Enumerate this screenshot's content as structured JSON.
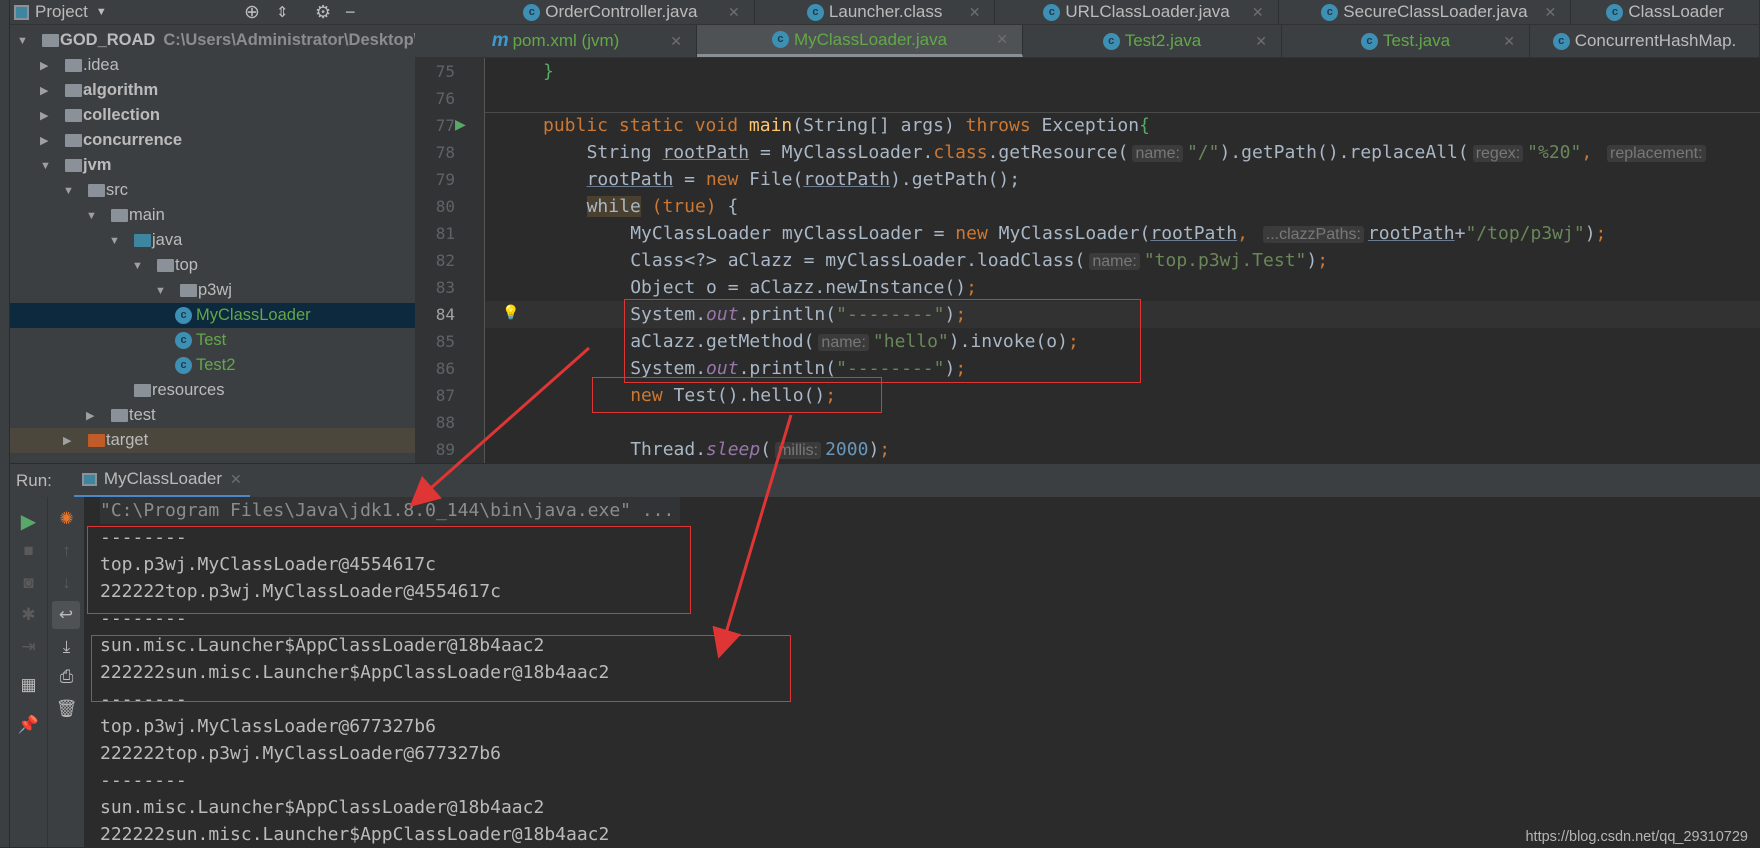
{
  "project_panel": {
    "title": "Project",
    "tree": [
      {
        "label": "GOD_ROAD",
        "path": "C:\\Users\\Administrator\\Desktop\\",
        "level": 0,
        "expanded": true,
        "icon": "module-folder",
        "bold": true
      },
      {
        "label": ".idea",
        "level": 1,
        "expanded": false,
        "icon": "folder"
      },
      {
        "label": "algorithm",
        "level": 1,
        "expanded": false,
        "icon": "module-folder",
        "bold": true
      },
      {
        "label": "collection",
        "level": 1,
        "expanded": false,
        "icon": "module-folder",
        "bold": true
      },
      {
        "label": "concurrence",
        "level": 1,
        "expanded": false,
        "icon": "module-folder",
        "bold": true
      },
      {
        "label": "jvm",
        "level": 1,
        "expanded": true,
        "icon": "module-folder",
        "bold": true
      },
      {
        "label": "src",
        "level": 2,
        "expanded": true,
        "icon": "folder"
      },
      {
        "label": "main",
        "level": 3,
        "expanded": true,
        "icon": "folder"
      },
      {
        "label": "java",
        "level": 4,
        "expanded": true,
        "icon": "source-folder"
      },
      {
        "label": "top",
        "level": 5,
        "expanded": true,
        "icon": "package"
      },
      {
        "label": "p3wj",
        "level": 6,
        "expanded": true,
        "icon": "package"
      },
      {
        "label": "MyClassLoader",
        "level": 7,
        "icon": "java-class",
        "selected": true
      },
      {
        "label": "Test",
        "level": 7,
        "icon": "java-class"
      },
      {
        "label": "Test2",
        "level": 7,
        "icon": "java-class"
      },
      {
        "label": "resources",
        "level": 4,
        "icon": "resources-folder"
      },
      {
        "label": "test",
        "level": 3,
        "expanded": false,
        "icon": "folder"
      },
      {
        "label": "target",
        "level": 2,
        "expanded": false,
        "icon": "excluded-folder",
        "highlighted": true
      }
    ]
  },
  "editor_tabs_row1": [
    {
      "label": "OrderController.java"
    },
    {
      "label": "Launcher.class"
    },
    {
      "label": "URLClassLoader.java"
    },
    {
      "label": "SecureClassLoader.java"
    },
    {
      "label": "ClassLoader"
    }
  ],
  "editor_tabs_row2": [
    {
      "label": "pom.xml (jvm)",
      "icon": "maven"
    },
    {
      "label": "MyClassLoader.java",
      "active": true
    },
    {
      "label": "Test2.java"
    },
    {
      "label": "Test.java"
    },
    {
      "label": "ConcurrentHashMap."
    }
  ],
  "editor": {
    "current_line": 84,
    "lines": [
      {
        "n": 75,
        "indent": 1,
        "tokens": [
          [
            "br",
            "}"
          ]
        ]
      },
      {
        "n": 76,
        "indent": 0,
        "tokens": []
      },
      {
        "n": 77,
        "indent": 1,
        "tokens": [
          [
            "kw",
            "public static void "
          ],
          [
            "fn",
            "main"
          ],
          [
            "",
            "(String[] args) "
          ],
          [
            "kw",
            "throws "
          ],
          [
            "",
            "Exception"
          ],
          [
            "br",
            "{"
          ]
        ]
      },
      {
        "n": 78,
        "indent": 2,
        "tokens": [
          [
            "",
            "String "
          ],
          [
            "u",
            "rootPath"
          ],
          [
            "",
            " = MyClassLoader."
          ],
          [
            "kw",
            "class"
          ],
          [
            "",
            ".getResource("
          ],
          [
            "hint",
            "name:"
          ],
          [
            "str",
            "\"/\""
          ],
          [
            "",
            ").getPath().replaceAll("
          ],
          [
            "hint",
            "regex:"
          ],
          [
            "str",
            "\"%20\""
          ],
          [
            "kw",
            ", "
          ],
          [
            "hint",
            "replacement:"
          ]
        ]
      },
      {
        "n": 79,
        "indent": 2,
        "tokens": [
          [
            "u",
            "rootPath"
          ],
          [
            "",
            " = "
          ],
          [
            "kw",
            "new "
          ],
          [
            "",
            "File("
          ],
          [
            "u",
            "rootPath"
          ],
          [
            "",
            ").getPath();"
          ]
        ]
      },
      {
        "n": 80,
        "indent": 2,
        "tokens": [
          [
            "hl",
            "while"
          ],
          [
            "kw",
            " (true) "
          ],
          [
            "",
            "{"
          ]
        ]
      },
      {
        "n": 81,
        "indent": 3,
        "tokens": [
          [
            "",
            "MyClassLoader myClassLoader = "
          ],
          [
            "kw",
            "new "
          ],
          [
            "",
            "MyClassLoader("
          ],
          [
            "u",
            "rootPath"
          ],
          [
            "kw",
            ", "
          ],
          [
            "hint",
            "...clazzPaths:"
          ],
          [
            "u",
            "rootPath"
          ],
          [
            "",
            "+"
          ],
          [
            "str",
            "\"/top/p3wj\""
          ],
          [
            "",
            ")"
          ],
          [
            "kw",
            ";"
          ]
        ]
      },
      {
        "n": 82,
        "indent": 3,
        "tokens": [
          [
            "",
            "Class<?> aClazz = myClassLoader.loadClass("
          ],
          [
            "hint",
            "name:"
          ],
          [
            "str",
            "\"top.p3wj.Test\""
          ],
          [
            "",
            ")"
          ],
          [
            "kw",
            ";"
          ]
        ]
      },
      {
        "n": 83,
        "indent": 3,
        "tokens": [
          [
            "",
            "Object o = aClazz.newInstance()"
          ],
          [
            "kw",
            ";"
          ]
        ]
      },
      {
        "n": 84,
        "indent": 3,
        "tokens": [
          [
            "",
            "System."
          ],
          [
            "static",
            "out"
          ],
          [
            "",
            ".println("
          ],
          [
            "str",
            "\"--------\""
          ],
          [
            "",
            ")"
          ],
          [
            "kw",
            ";"
          ]
        ]
      },
      {
        "n": 85,
        "indent": 3,
        "tokens": [
          [
            "",
            "aClazz.getMethod("
          ],
          [
            "hint",
            "name:"
          ],
          [
            "str",
            "\"hello\""
          ],
          [
            "",
            ").invoke(o)"
          ],
          [
            "kw",
            ";"
          ]
        ]
      },
      {
        "n": 86,
        "indent": 3,
        "tokens": [
          [
            "",
            "System."
          ],
          [
            "static",
            "out"
          ],
          [
            "",
            ".println("
          ],
          [
            "str",
            "\"--------\""
          ],
          [
            "",
            ")"
          ],
          [
            "kw",
            ";"
          ]
        ]
      },
      {
        "n": 87,
        "indent": 3,
        "tokens": [
          [
            "kw",
            "new "
          ],
          [
            "",
            "Test().hello()"
          ],
          [
            "kw",
            ";"
          ]
        ]
      },
      {
        "n": 88,
        "indent": 0,
        "tokens": []
      },
      {
        "n": 89,
        "indent": 3,
        "tokens": [
          [
            "",
            "Thread."
          ],
          [
            "static",
            "sleep"
          ],
          [
            "",
            "("
          ],
          [
            "hint",
            "millis:"
          ],
          [
            "num",
            "2000"
          ],
          [
            "",
            ")"
          ],
          [
            "kw",
            ";"
          ]
        ]
      }
    ]
  },
  "run_panel": {
    "label": "Run:",
    "tab": "MyClassLoader",
    "output": [
      "\"C:\\Program Files\\Java\\jdk1.8.0_144\\bin\\java.exe\" ...",
      "--------",
      "top.p3wj.MyClassLoader@4554617c",
      "222222top.p3wj.MyClassLoader@4554617c",
      "--------",
      "sun.misc.Launcher$AppClassLoader@18b4aac2",
      "222222sun.misc.Launcher$AppClassLoader@18b4aac2",
      "--------",
      "top.p3wj.MyClassLoader@677327b6",
      "222222top.p3wj.MyClassLoader@677327b6",
      "--------",
      "sun.misc.Launcher$AppClassLoader@18b4aac2",
      "222222sun.misc.Launcher$AppClassLoader@18b4aac2"
    ]
  },
  "watermark": "https://blog.csdn.net/qq_29310729",
  "colors": {
    "annotation_red": "#e03535",
    "keyword": "#cc7832",
    "string": "#6a8759",
    "selection": "#0d293e"
  }
}
